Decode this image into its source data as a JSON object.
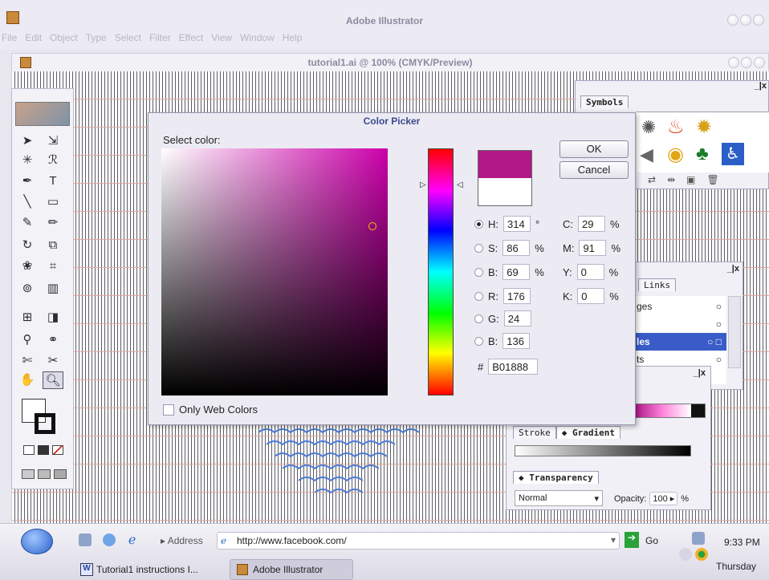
{
  "app": {
    "title": "Adobe Illustrator",
    "menu": [
      "File",
      "Edit",
      "Object",
      "Type",
      "Select",
      "Filter",
      "Effect",
      "View",
      "Window",
      "Help"
    ]
  },
  "document": {
    "title": "tutorial1.ai @ 100% (CMYK/Preview)"
  },
  "panels": {
    "symbols_tab": "Symbols",
    "links_tab": "Links",
    "layers_rows": [
      "ges",
      "",
      "les",
      "ts"
    ],
    "stroke_tab": "Stroke",
    "gradient_tab": "Gradient",
    "transparency_tab": "Transparency",
    "blend_mode": "Normal",
    "opacity_label": "Opacity:",
    "opacity_value": "100",
    "opacity_unit": "%"
  },
  "color_picker": {
    "title": "Color Picker",
    "select_label": "Select color:",
    "ok_label": "OK",
    "cancel_label": "Cancel",
    "only_web_label": "Only Web Colors",
    "current_color": "#B01888",
    "previous_color": "#FFFFFF",
    "hsb": [
      {
        "label": "H:",
        "value": "314",
        "unit": "°"
      },
      {
        "label": "S:",
        "value": "86",
        "unit": "%"
      },
      {
        "label": "B:",
        "value": "69",
        "unit": "%"
      }
    ],
    "rgb": [
      {
        "label": "R:",
        "value": "176"
      },
      {
        "label": "G:",
        "value": "24"
      },
      {
        "label": "B:",
        "value": "136"
      }
    ],
    "cmyk": [
      {
        "label": "C:",
        "value": "29",
        "unit": "%"
      },
      {
        "label": "M:",
        "value": "91",
        "unit": "%"
      },
      {
        "label": "Y:",
        "value": "0",
        "unit": "%"
      },
      {
        "label": "K:",
        "value": "0",
        "unit": "%"
      }
    ],
    "hex_label": "#",
    "hex_value": "B01888"
  },
  "taskbar": {
    "address_label": "Address",
    "address_value": "http://www.facebook.com/",
    "go_label": "Go",
    "task1": "Tutorial1 instructions I...",
    "task2": "Adobe Illustrator",
    "time": "9:33 PM",
    "day": "Thursday"
  }
}
